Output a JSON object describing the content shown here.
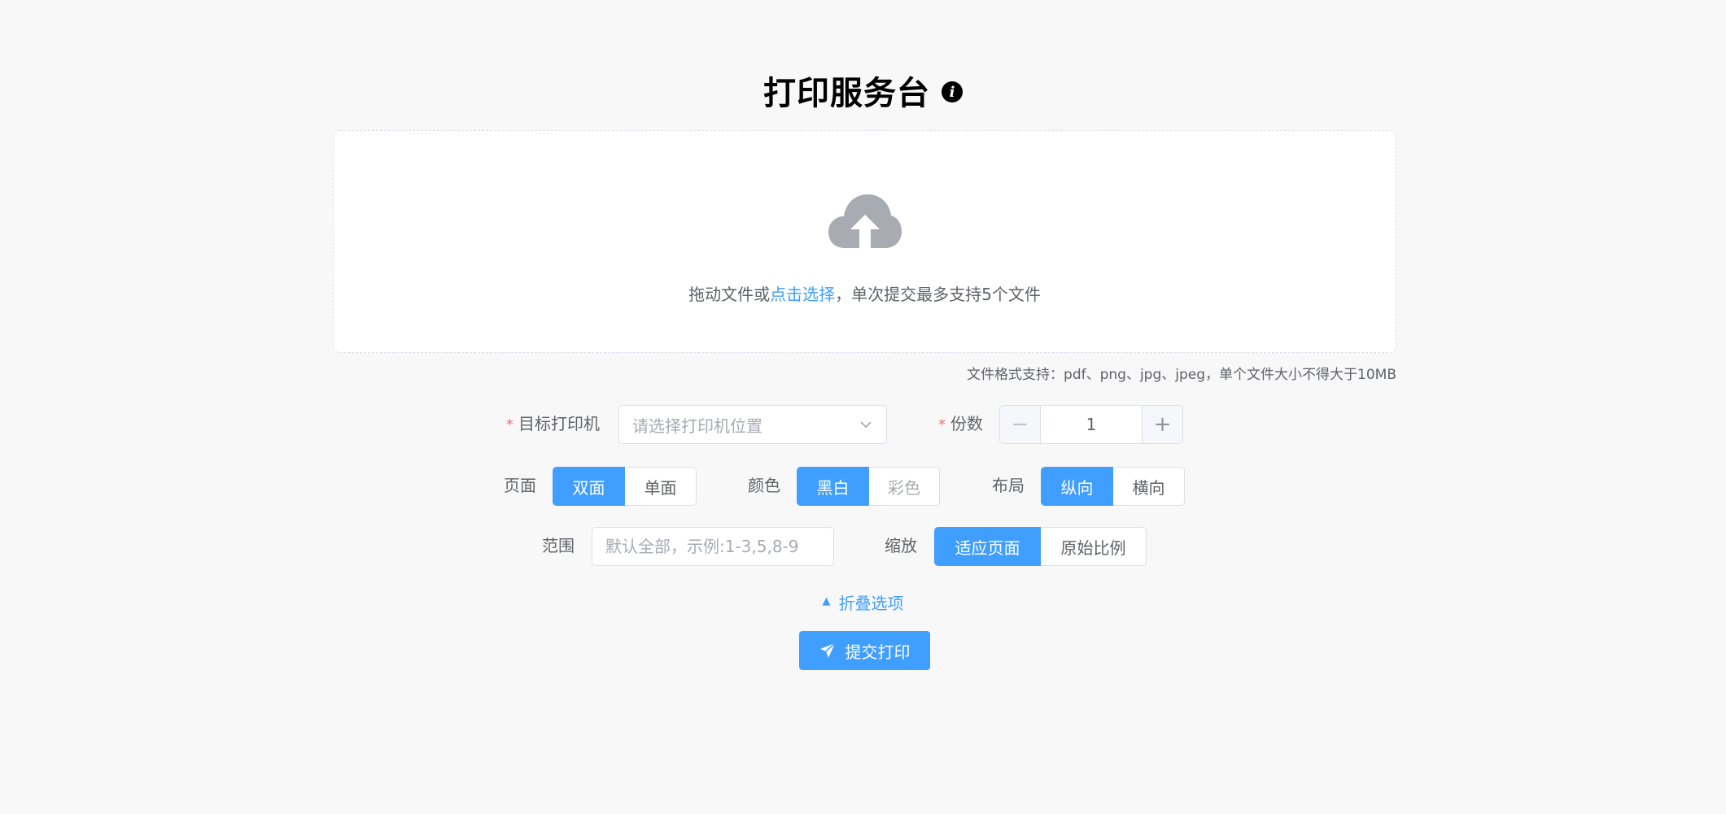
{
  "header": {
    "title": "打印服务台",
    "info_icon": "info-icon"
  },
  "upload": {
    "icon": "cloud-upload-icon",
    "text_before": "拖动文件或",
    "link": "点击选择",
    "text_after": "，单次提交最多支持5个文件",
    "format_tip": "文件格式支持：pdf、png、jpg、jpeg，单个文件大小不得大于10MB"
  },
  "form": {
    "required_mark": "*",
    "printer": {
      "label": "目标打印机",
      "placeholder": "请选择打印机位置"
    },
    "copies": {
      "label": "份数",
      "value": "1",
      "minus": "−",
      "plus": "+"
    },
    "sides": {
      "label": "页面",
      "options": [
        "双面",
        "单面"
      ],
      "selected": "双面"
    },
    "color": {
      "label": "颜色",
      "options": [
        "黑白",
        "彩色"
      ],
      "selected": "黑白",
      "disabled": "彩色"
    },
    "layout": {
      "label": "布局",
      "options": [
        "纵向",
        "横向"
      ],
      "selected": "纵向"
    },
    "range": {
      "label": "范围",
      "placeholder": "默认全部，示例:1-3,5,8-9"
    },
    "scale": {
      "label": "缩放",
      "options": [
        "适应页面",
        "原始比例"
      ],
      "selected": "适应页面"
    },
    "collapse_label": "折叠选项",
    "submit_label": "提交打印"
  },
  "colors": {
    "accent": "#409eff",
    "required": "#f56c6c",
    "background": "#f8f8f8"
  }
}
